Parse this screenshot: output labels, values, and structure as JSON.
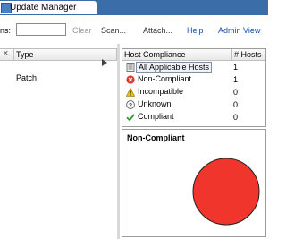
{
  "tab": {
    "title": "Update Manager",
    "icon": "update-manager-icon"
  },
  "toolbar": {
    "search_label": "ns:",
    "search_value": "",
    "clear_label": "Clear",
    "scan_label": "Scan...",
    "attach_label": "Attach...",
    "help_label": "Help",
    "admin_view_label": "Admin View"
  },
  "left_grid": {
    "columns": [
      "Type"
    ],
    "rows": [
      {
        "type": "Patch"
      }
    ]
  },
  "host_compliance": {
    "header_label": "Host Compliance",
    "count_label": "# Hosts",
    "rows": [
      {
        "label": "All Applicable Hosts",
        "count": "1",
        "icon": "all-hosts-icon",
        "selected": true
      },
      {
        "label": "Non-Compliant",
        "count": "1",
        "icon": "non-compliant-icon",
        "selected": false
      },
      {
        "label": "Incompatible",
        "count": "0",
        "icon": "incompatible-icon",
        "selected": false
      },
      {
        "label": "Unknown",
        "count": "0",
        "icon": "unknown-icon",
        "selected": false
      },
      {
        "label": "Compliant",
        "count": "0",
        "icon": "compliant-icon",
        "selected": false
      }
    ]
  },
  "chart_data": {
    "type": "pie",
    "title": "Non-Compliant",
    "categories": [
      "Non-Compliant"
    ],
    "values": [
      1
    ],
    "colors": [
      "#f0352c"
    ]
  },
  "colors": {
    "tab_strip": "#3b6ea8",
    "link": "#1b4fa6",
    "non_compliant": "#f0352c",
    "compliant": "#2a9a2a",
    "incompatible": "#f2c200"
  }
}
